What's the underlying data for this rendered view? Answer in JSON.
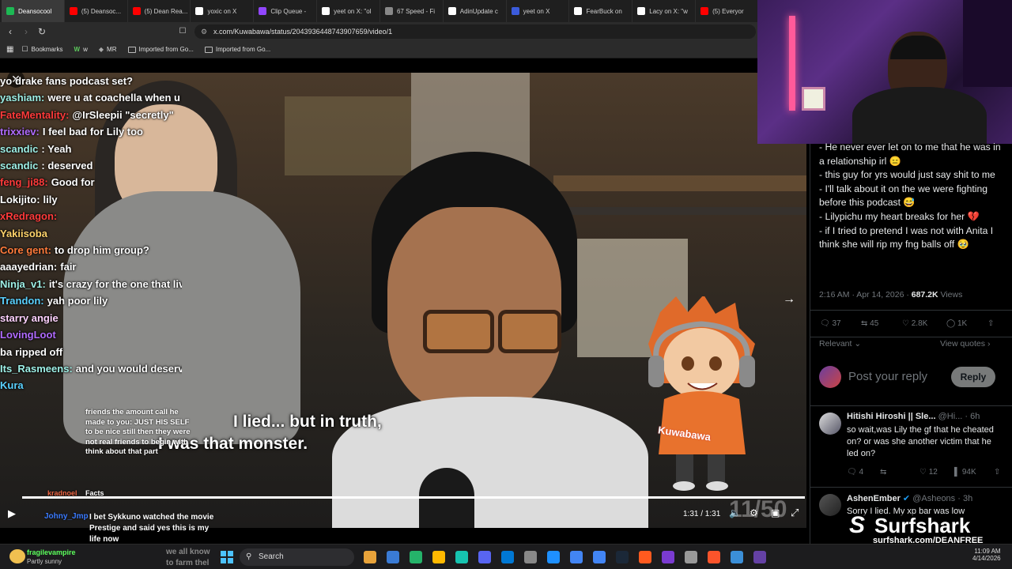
{
  "browser": {
    "tabs": [
      {
        "label": "Deansocool",
        "color": "#1db954"
      },
      {
        "label": "(5) Deansoc...",
        "color": "#ff0000"
      },
      {
        "label": "(5) Dean Rea...",
        "color": "#ff0000"
      },
      {
        "label": "yoxic on X",
        "color": "#ffffff"
      },
      {
        "label": "Clip Queue -",
        "color": "#9146ff"
      },
      {
        "label": "yeet on X: \"ol",
        "color": "#ffffff"
      },
      {
        "label": "67 Speed - Fi",
        "color": "#888888"
      },
      {
        "label": "AdinUpdate c",
        "color": "#ffffff"
      },
      {
        "label": "yeet on X",
        "color": "#3b5bdb"
      },
      {
        "label": "FearBuck on",
        "color": "#ffffff"
      },
      {
        "label": "Lacy on X: \"w",
        "color": "#ffffff"
      },
      {
        "label": "(5) Everyor",
        "color": "#ff0000"
      }
    ],
    "url": "x.com/Kuwabawa/status/2043936448743907659/video/1",
    "bookmarks": [
      "Bookmarks",
      "w",
      "MR",
      "Imported from Go...",
      "Imported from Go..."
    ]
  },
  "video": {
    "caption_line1": "I lied... but in truth,",
    "caption_line2": "I was that monster.",
    "chibi_label": "Kuwabawa",
    "watermark": "11/50",
    "time": "1:31 / 1:31",
    "progress": 1.0,
    "overlay_chat": [
      {
        "user": "friends the amount call he",
        "text": ""
      },
      {
        "user": "made to you:",
        "text": "JUST HIS SELF"
      },
      {
        "user": "to be nice still then they were",
        "text": ""
      },
      {
        "user": "not real friends to begin with",
        "text": ""
      },
      {
        "user": "think about that part",
        "text": ""
      }
    ],
    "small_chat": [
      {
        "user": "kradnoel",
        "text": "Facts"
      },
      {
        "user": "Johny_Jmp",
        "text": "I bet Sykkuno watched the movie Prestige and said yes this is my life now"
      }
    ]
  },
  "chat": [
    {
      "user": "yo",
      "text": "drake fans podcast set?",
      "color": "#ffffff"
    },
    {
      "user": "yashiam:",
      "text": "were u at coachella when u saw it?",
      "color": "#9ef0e6"
    },
    {
      "user": "FateMentality:",
      "text": "@IrSleepii \"secretly\"",
      "color": "#ff3b3b"
    },
    {
      "user": "trixxiev:",
      "text": "I feel bad for Lily too",
      "color": "#b06bff"
    },
    {
      "user": "scandic",
      "text": ": Yeah",
      "color": "#9ef0e6"
    },
    {
      "user": "scandic",
      "text": ": deserved",
      "color": "#9ef0e6"
    },
    {
      "user": "feng_ji88:",
      "text": "Good for",
      "color": "#ff3b3b"
    },
    {
      "user": "Lokijito:",
      "text": "lily",
      "color": "#ffffff"
    },
    {
      "user": "xRedragon:",
      "text": "",
      "color": "#ff3b3b"
    },
    {
      "user": "Yakiisoba",
      "text": "",
      "color": "#ffd36b"
    },
    {
      "user": "Core gent:",
      "text": "to drop him group?",
      "color": "#ff7b3b"
    },
    {
      "user": "aaayedrian:",
      "text": "fair",
      "color": "#ffffff"
    },
    {
      "user": "Ninja_v1:",
      "text": "it's crazy for the one that lived wi for years",
      "color": "#9ef0e6"
    },
    {
      "user": "Trandon:",
      "text": "yah poor lily",
      "color": "#5ad1ff"
    },
    {
      "user": "starry angie",
      "text": "",
      "color": "#ffd3ff"
    },
    {
      "user": "LovingLoot",
      "text": "",
      "color": "#b06bff"
    },
    {
      "user": "ba",
      "text": "ripped off",
      "color": "#ffffff"
    },
    {
      "user": "Its_Rasmeens:",
      "text": "and you would deserve it",
      "color": "#9ef0e6"
    },
    {
      "user": "Kura",
      "text": "",
      "color": "#5ad1ff"
    }
  ],
  "tweet": {
    "lines": [
      "- He never ever let on to me that he was in a relationship irl 😑",
      "- this guy for yrs would just say shit to me",
      "- I'll talk about it on the we were fighting before this podcast 😅",
      "- Lilypichu my heart breaks for her 💔",
      "- if I tried to pretend I was not with Anita I think she will rip my fng balls off 🥹"
    ],
    "timestamp": "2:16 AM · Apr 14, 2026",
    "views_count": "687.2K",
    "views_label": "Views",
    "replies": "37",
    "retweets": "45",
    "likes": "2.8K",
    "bookmarks": "1K",
    "sort_label": "Relevant",
    "view_quotes": "View quotes",
    "reply_placeholder": "Post your reply",
    "reply_button": "Reply"
  },
  "replies": [
    {
      "name": "Hitishi Hiroshi || Sle...",
      "handle": "@Hi...",
      "time": "6h",
      "text": "so wait,was Lily the gf that he cheated on? or was she another victim that he led on?",
      "replies": "4",
      "retweets": "",
      "likes": "12",
      "views": "94K"
    },
    {
      "name": "AshenEmber",
      "handle": "@Asheons",
      "time": "3h",
      "text": "Sorry I lied. My xp bar was low"
    }
  ],
  "sponsor": {
    "brand": "Surfshark",
    "url": "surfshark.com/DEANFREE"
  },
  "taskbar": {
    "weather_user": "fragilevampire",
    "weather_text": "Partly sunny",
    "search_placeholder": "Search",
    "time": "11:09 AM",
    "date": "4/14/2026",
    "overlay_text1": "we all know",
    "overlay_text2": "to farm thel"
  },
  "colors": {
    "x_blue": "#1d9bf0",
    "accent_like": "#f91880"
  }
}
